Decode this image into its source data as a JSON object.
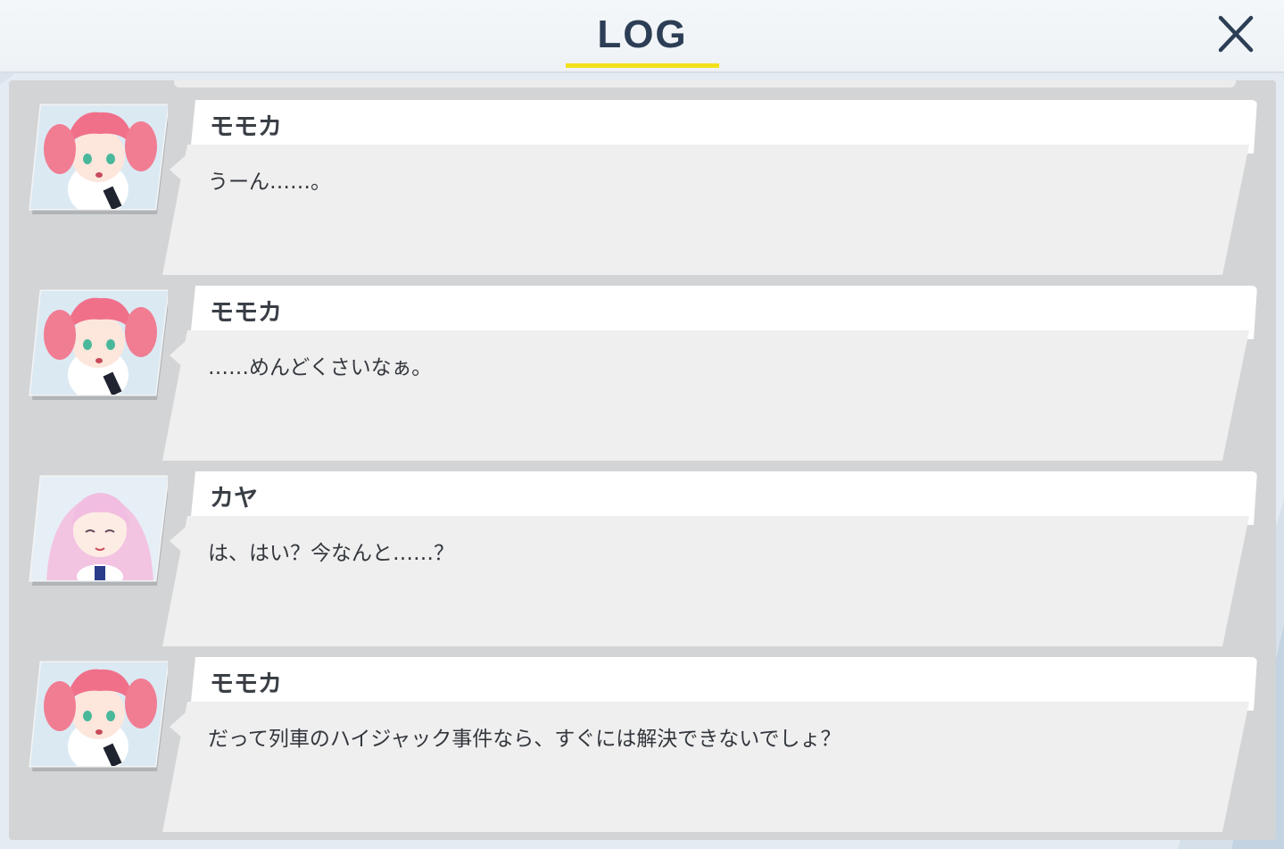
{
  "header": {
    "title": "LOG",
    "close_icon": "close-icon"
  },
  "colors": {
    "title": "#2c3e55",
    "underline": "#f3e01a",
    "panel": "#d2d4d6",
    "name_tab": "#ffffff",
    "message_box": "#efefef"
  },
  "entries": [
    {
      "speaker": "モモカ",
      "message": "うーん……。",
      "portrait": "momoka-portrait"
    },
    {
      "speaker": "モモカ",
      "message": "……めんどくさいなぁ。",
      "portrait": "momoka-portrait"
    },
    {
      "speaker": "カヤ",
      "message": "は、はい？今なんと……？",
      "portrait": "kaya-portrait"
    },
    {
      "speaker": "モモカ",
      "message": "だって列車のハイジャック事件なら、すぐには解決できないでしょ？",
      "portrait": "momoka-portrait"
    }
  ]
}
